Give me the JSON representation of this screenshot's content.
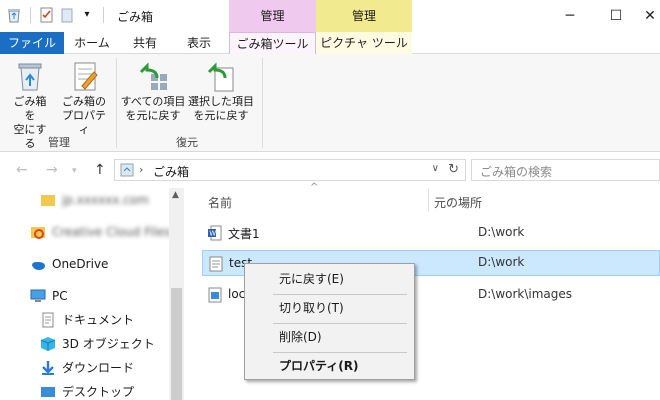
{
  "window": {
    "title": "ごみ箱",
    "context_tab_manage_pink": "管理",
    "context_tab_manage_yellow": "管理",
    "minimize": "─",
    "maximize": "☐",
    "close": "✕"
  },
  "tabs": [
    "ファイル",
    "ホーム",
    "共有",
    "表示",
    "ごみ箱ツール",
    "ピクチャ ツール"
  ],
  "ribbon": {
    "empty_bin": [
      "ごみ箱を",
      "空にする"
    ],
    "bin_props": [
      "ごみ箱の",
      "プロパティ"
    ],
    "group_manage": "管理",
    "restore_all": [
      "すべての項目",
      "を元に戻す"
    ],
    "restore_selected": [
      "選択した項目",
      "を元に戻す"
    ],
    "group_restore": "復元"
  },
  "address": {
    "crumb": "ごみ箱",
    "search_placeholder": "ごみ箱の検索"
  },
  "nav": {
    "item_blur1": "jp.xxxxxx.com",
    "item_blur2": "Creative Cloud Files",
    "onedrive": "OneDrive",
    "pc": "PC",
    "documents": "ドキュメント",
    "objects3d": "3D オブジェクト",
    "downloads": "ダウンロード",
    "desktop": "デスクトップ"
  },
  "columns": {
    "name": "名前",
    "location": "元の場所"
  },
  "files": [
    {
      "name": "文書1",
      "location": "D:\\work"
    },
    {
      "name": "test",
      "location": "D:\\work"
    },
    {
      "name": "loc",
      "location": "D:\\work\\images"
    }
  ],
  "context_menu": {
    "restore": "元に戻す(E)",
    "cut": "切り取り(T)",
    "delete": "削除(D)",
    "properties": "プロパティ(R)"
  },
  "colors": {
    "file_tab": "#1a6fc4",
    "selection": "#cce8ff",
    "recycle_tools": "#f0c9ee",
    "picture_tools": "#f1ea8e"
  }
}
